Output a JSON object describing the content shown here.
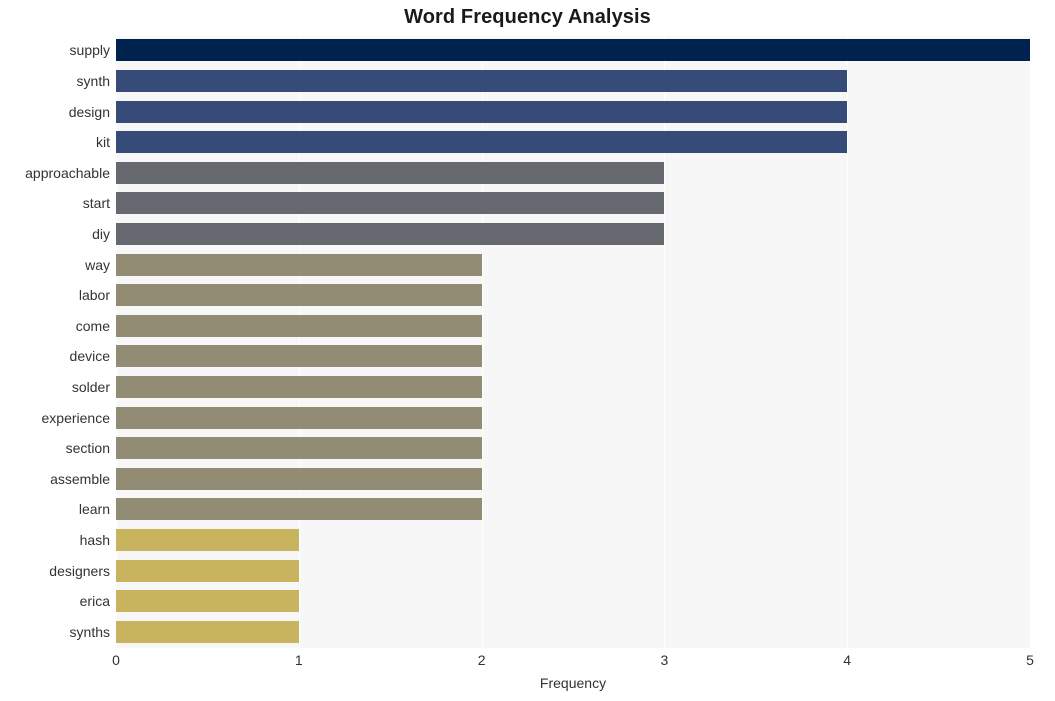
{
  "chart_data": {
    "type": "bar",
    "orientation": "horizontal",
    "title": "Word Frequency Analysis",
    "xlabel": "Frequency",
    "ylabel": "",
    "xlim": [
      0,
      5
    ],
    "xticks": [
      "0",
      "1",
      "2",
      "3",
      "4",
      "5"
    ],
    "grid": true,
    "legend": "none",
    "categories": [
      "supply",
      "synth",
      "design",
      "kit",
      "approachable",
      "start",
      "diy",
      "way",
      "labor",
      "come",
      "device",
      "solder",
      "experience",
      "section",
      "assemble",
      "learn",
      "hash",
      "designers",
      "erica",
      "synths"
    ],
    "values": [
      5,
      4,
      4,
      4,
      3,
      3,
      3,
      2,
      2,
      2,
      2,
      2,
      2,
      2,
      2,
      2,
      1,
      1,
      1,
      1
    ],
    "bar_colors": [
      "#00224e",
      "#364b78",
      "#364b78",
      "#364b78",
      "#65686f",
      "#65686f",
      "#65686f",
      "#928c74",
      "#928c74",
      "#928c74",
      "#928c74",
      "#928c74",
      "#928c74",
      "#928c74",
      "#928c74",
      "#928c74",
      "#c8b45e",
      "#c8b45e",
      "#c8b45e",
      "#c8b45e"
    ]
  },
  "style": {
    "plot_background": "#f7f7f7",
    "figure_background": "#ffffff",
    "gridline_color": "#ffffff",
    "text_color": "#333333",
    "title_color": "#1a1a1a"
  }
}
